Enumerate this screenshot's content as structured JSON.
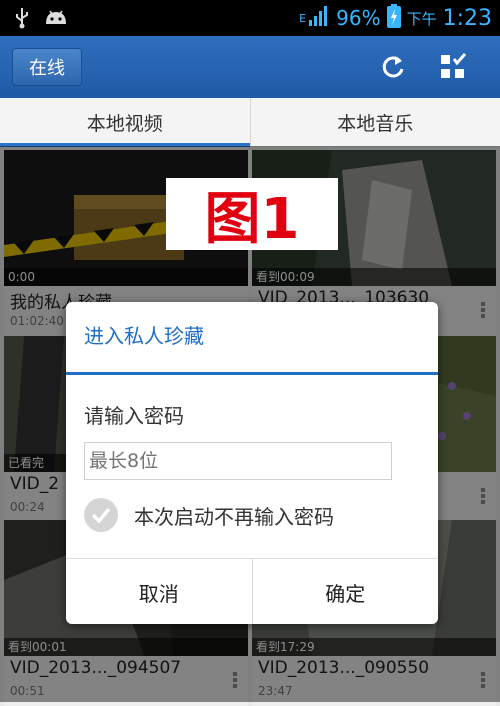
{
  "status_bar": {
    "network": "E",
    "battery": "96%",
    "ampm": "下午",
    "time": "1:23",
    "icons": [
      "usb-icon",
      "android-icon",
      "signal-icon",
      "battery-icon"
    ]
  },
  "action_bar": {
    "back_label": "在线",
    "icons": [
      "refresh-icon",
      "multi-select-icon"
    ]
  },
  "tabs": [
    {
      "label": "本地视频",
      "active": true
    },
    {
      "label": "本地音乐",
      "active": false
    }
  ],
  "figure_label": "图1",
  "videos": [
    {
      "title": "我的私人珍藏",
      "meta": "01:02:40",
      "overlay": "0:00"
    },
    {
      "title": "VID_2013..._103630",
      "meta": "",
      "overlay": "看到00:09"
    },
    {
      "title": "VID_2",
      "meta": "00:24",
      "overlay": "已看完"
    },
    {
      "title": "",
      "meta": "",
      "overlay": ""
    },
    {
      "title": "VID_2013..._094507",
      "meta": "00:51",
      "overlay": "看到00:01"
    },
    {
      "title": "VID_2013..._090550",
      "meta": "23:47",
      "overlay": "看到17:29"
    }
  ],
  "dialog": {
    "title": "进入私人珍藏",
    "prompt": "请输入密码",
    "input_placeholder": "最长8位",
    "checkbox_label": "本次启动不再输入密码",
    "checkbox_checked": true,
    "cancel_label": "取消",
    "ok_label": "确定"
  },
  "colors": {
    "accent": "#1f6fc5",
    "action_bar": "#2563ad",
    "status_text": "#39b6ff",
    "figure_label": "#e00010"
  }
}
